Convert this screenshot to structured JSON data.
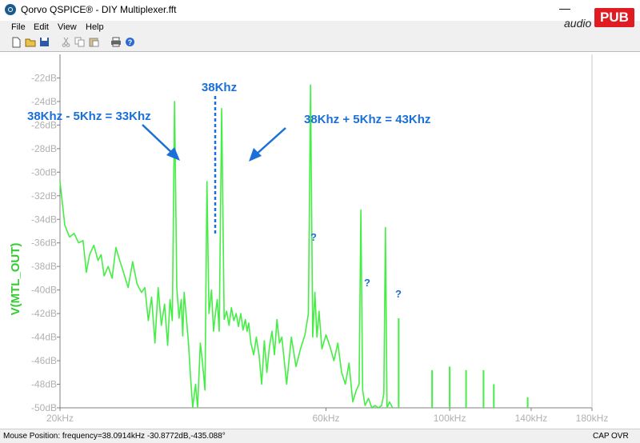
{
  "window": {
    "title": "Qorvo QSPICE® - DIY Multiplexer.fft",
    "minimize_glyph": "—",
    "app_icon": "qspice-app-icon"
  },
  "watermark": {
    "word": "audio",
    "badge": "PUB"
  },
  "menu": [
    "File",
    "Edit",
    "View",
    "Help"
  ],
  "toolbar": {
    "icons": [
      "new-file-icon",
      "open-folder-icon",
      "save-icon",
      "cut-icon",
      "copy-icon",
      "paste-icon",
      "print-icon",
      "help-icon"
    ]
  },
  "status": {
    "mouse_position": "Mouse Position: frequency=38.0914kHz   -30.8772dB,-435.088°",
    "cap": "CAP",
    "ovr": "OVR"
  },
  "annotations": {
    "carrier": "38Khz",
    "lower_sideband": "38Khz - 5Khz = 33Khz",
    "upper_sideband": "38Khz + 5Khz = 43Khz",
    "question_marks": [
      "?",
      "?",
      "?"
    ]
  },
  "colors": {
    "trace": "#44ee44",
    "annotation": "#1a6fd8",
    "axis_text": "#b0b0b0",
    "ylabel": "#33cc33"
  },
  "chart_data": {
    "type": "line",
    "title": "",
    "xlabel": "",
    "ylabel": "V(MTL_OUT)",
    "xscale": "log",
    "xlim": [
      20,
      180
    ],
    "ylim": [
      -50,
      -20
    ],
    "grid": false,
    "x_ticks": [
      {
        "value": 20,
        "label": "20kHz"
      },
      {
        "value": 60,
        "label": "60kHz"
      },
      {
        "value": 100,
        "label": "100kHz"
      },
      {
        "value": 140,
        "label": "140kHz"
      },
      {
        "value": 180,
        "label": "180kHz"
      }
    ],
    "y_ticks": [
      {
        "value": -22,
        "label": "-22dB"
      },
      {
        "value": -24,
        "label": "-24dB"
      },
      {
        "value": -26,
        "label": "-26dB"
      },
      {
        "value": -28,
        "label": "-28dB"
      },
      {
        "value": -30,
        "label": "-30dB"
      },
      {
        "value": -32,
        "label": "-32dB"
      },
      {
        "value": -34,
        "label": "-34dB"
      },
      {
        "value": -36,
        "label": "-36dB"
      },
      {
        "value": -38,
        "label": "-38dB"
      },
      {
        "value": -40,
        "label": "-40dB"
      },
      {
        "value": -42,
        "label": "-42dB"
      },
      {
        "value": -44,
        "label": "-44dB"
      },
      {
        "value": -46,
        "label": "-46dB"
      },
      {
        "value": -48,
        "label": "-48dB"
      },
      {
        "value": -50,
        "label": "-50dB"
      }
    ],
    "series": [
      {
        "name": "V(MTL_OUT)",
        "x": [
          20.0,
          20.4,
          20.8,
          21.2,
          21.6,
          22.0,
          22.3,
          22.6,
          23.0,
          23.4,
          23.7,
          24.0,
          24.4,
          24.8,
          25.2,
          25.6,
          26.0,
          26.5,
          27.0,
          27.5,
          28.0,
          28.4,
          28.8,
          29.2,
          29.6,
          30.0,
          30.4,
          30.8,
          31.2,
          31.5,
          31.8,
          32.1,
          32.4,
          32.7,
          33.0,
          33.2,
          33.4,
          33.7,
          34.0,
          34.3,
          34.6,
          35.0,
          35.3,
          35.7,
          36.0,
          36.4,
          36.7,
          37.0,
          37.4,
          37.7,
          38.0,
          38.3,
          38.6,
          39.0,
          39.4,
          39.8,
          40.2,
          40.6,
          41.0,
          41.4,
          41.8,
          42.2,
          42.6,
          43.0,
          43.3,
          43.6,
          44.0,
          44.5,
          45.0,
          45.5,
          46.0,
          46.5,
          47.0,
          47.5,
          48.0,
          48.5,
          49.0,
          49.5,
          50.0,
          51.0,
          52.0,
          53.0,
          54.0,
          55.0,
          55.8,
          56.3,
          56.8,
          57.3,
          57.8,
          58.3,
          59.0,
          60.0,
          61.0,
          62.0,
          63.0,
          64.0,
          65.0,
          66.0,
          67.0,
          68.0,
          68.8,
          69.3,
          69.8,
          70.5,
          71.5,
          72.5,
          73.5,
          74.5,
          75.5,
          76.2,
          76.7,
          77.2,
          78.0,
          79.0
        ],
        "y": [
          -30.8,
          -34.5,
          -35.5,
          -35.2,
          -36.0,
          -35.8,
          -38.5,
          -37.0,
          -36.2,
          -37.5,
          -37.0,
          -38.8,
          -38.0,
          -39.0,
          -36.4,
          -37.5,
          -38.5,
          -39.8,
          -37.6,
          -39.5,
          -40.2,
          -39.8,
          -42.6,
          -40.6,
          -44.5,
          -39.8,
          -43.0,
          -41.2,
          -44.7,
          -40.8,
          -42.6,
          -24.0,
          -39.8,
          -42.4,
          -40.8,
          -43.9,
          -40.2,
          -42.3,
          -44.5,
          -47.5,
          -50.0,
          -48.0,
          -50.0,
          -44.5,
          -46.0,
          -48.5,
          -30.8,
          -42.0,
          -40.0,
          -43.5,
          -42.0,
          -40.8,
          -43.5,
          -24.6,
          -42.5,
          -41.8,
          -43.0,
          -41.5,
          -42.6,
          -42.0,
          -43.1,
          -42.0,
          -43.4,
          -42.5,
          -43.5,
          -42.8,
          -44.5,
          -45.5,
          -44.0,
          -45.5,
          -48.0,
          -44.3,
          -47.0,
          -44.8,
          -43.5,
          -45.5,
          -42.5,
          -44.5,
          -44.0,
          -48.0,
          -44.0,
          -46.5,
          -45.0,
          -43.8,
          -42.0,
          -22.6,
          -44.0,
          -40.2,
          -44.0,
          -41.8,
          -45.0,
          -43.8,
          -44.8,
          -46.0,
          -44.5,
          -47.0,
          -48.0,
          -46.2,
          -49.5,
          -48.5,
          -48.0,
          -33.2,
          -48.5,
          -49.8,
          -49.2,
          -50.0,
          -49.8,
          -50.0,
          -49.8,
          -48.8,
          -34.7,
          -50.0,
          -49.5,
          -50.0
        ]
      }
    ],
    "spurs": [
      {
        "x": 81.0,
        "y": -42.4
      },
      {
        "x": 93.0,
        "y": -46.8
      },
      {
        "x": 100.0,
        "y": -46.5
      },
      {
        "x": 107.0,
        "y": -46.8
      },
      {
        "x": 115.0,
        "y": -46.8
      },
      {
        "x": 120.0,
        "y": -48.0
      },
      {
        "x": 138.0,
        "y": -49.1
      }
    ]
  }
}
